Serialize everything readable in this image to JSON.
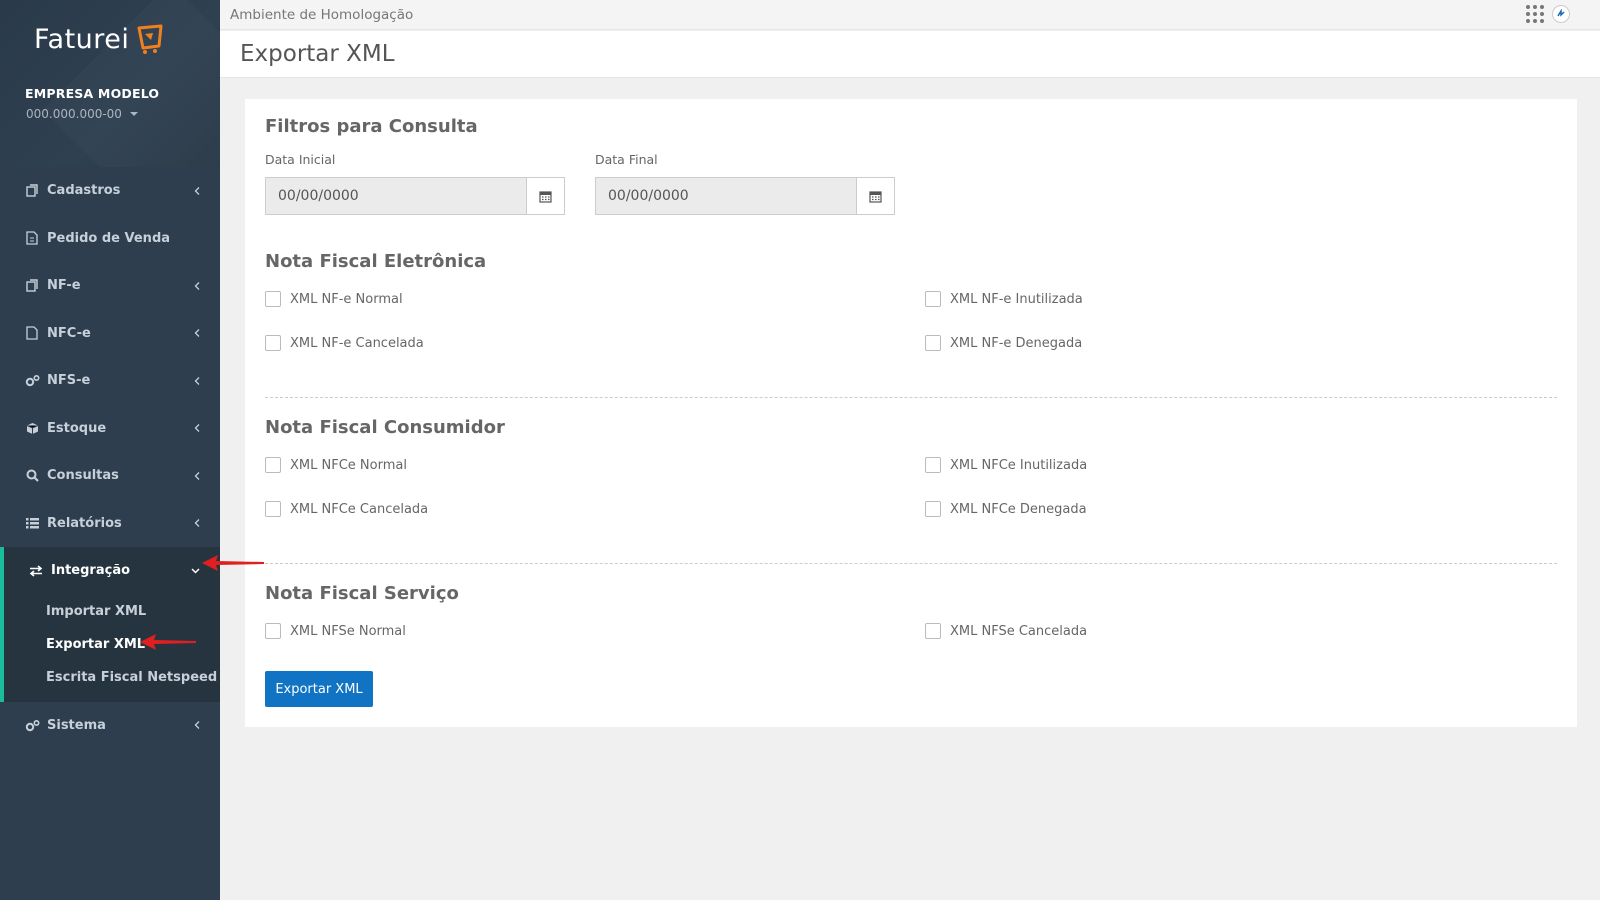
{
  "app": {
    "logo_text": "Faturei",
    "company_name": "EMPRESA MODELO",
    "company_id": "000.000.000-00"
  },
  "topbar": {
    "environment": "Ambiente de Homologação"
  },
  "page": {
    "title": "Exportar XML"
  },
  "sidebar": {
    "items": [
      {
        "label": "Cadastros",
        "icon": "copy-icon"
      },
      {
        "label": "Pedido de Venda",
        "icon": "document-icon"
      },
      {
        "label": "NF-e",
        "icon": "files-icon"
      },
      {
        "label": "NFC-e",
        "icon": "file-icon"
      },
      {
        "label": "NFS-e",
        "icon": "cogs-icon"
      },
      {
        "label": "Estoque",
        "icon": "box-icon"
      },
      {
        "label": "Consultas",
        "icon": "search-icon"
      },
      {
        "label": "Relatórios",
        "icon": "list-icon"
      }
    ],
    "group": {
      "label": "Integração",
      "icon": "exchange-icon",
      "subitems": [
        {
          "label": "Importar XML"
        },
        {
          "label": "Exportar XML"
        },
        {
          "label": "Escrita Fiscal Netspeed"
        }
      ]
    },
    "last_item": {
      "label": "Sistema",
      "icon": "cogs-icon"
    }
  },
  "filters": {
    "title": "Filtros para Consulta",
    "start_label": "Data Inicial",
    "start_value": "00/00/0000",
    "end_label": "Data Final",
    "end_value": "00/00/0000"
  },
  "nfe": {
    "title": "Nota Fiscal Eletrônica",
    "options": [
      "XML NF-e Normal",
      "XML NF-e Inutilizada",
      "XML NF-e Cancelada",
      "XML NF-e Denegada"
    ]
  },
  "nfce": {
    "title": "Nota Fiscal Consumidor",
    "options": [
      "XML NFCe Normal",
      "XML NFCe Inutilizada",
      "XML NFCe Cancelada",
      "XML NFCe Denegada"
    ]
  },
  "nfse": {
    "title": "Nota Fiscal Serviço",
    "options": [
      "XML NFSe Normal",
      "XML NFSe Cancelada"
    ]
  },
  "actions": {
    "export_label": "Exportar XML"
  },
  "colors": {
    "sidebar_bg": "#2e3e4e",
    "accent_green": "#1abc9c",
    "logo_orange": "#f07d1a",
    "button_blue": "#1173c3",
    "annotation_red": "#e02020"
  }
}
